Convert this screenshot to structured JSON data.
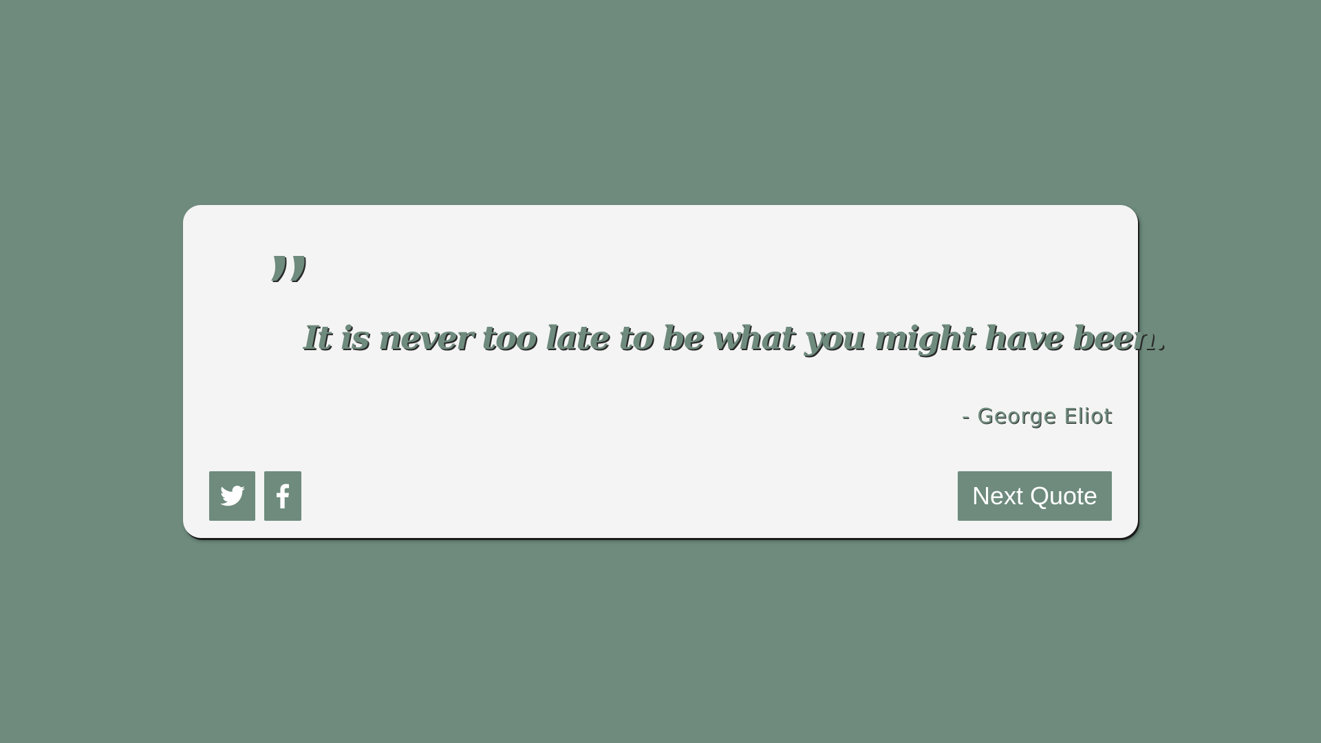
{
  "colors": {
    "background": "#6e8b7d",
    "card": "#f4f4f4",
    "accent": "#6e8b7d",
    "button_text": "#ffffff"
  },
  "quote": {
    "icon": "quote-mark-icon",
    "text": "It is never too late to be what you might have been.",
    "author": "- George Eliot"
  },
  "actions": {
    "twitter_icon": "twitter-icon",
    "facebook_icon": "facebook-icon",
    "next_label": "Next Quote"
  }
}
